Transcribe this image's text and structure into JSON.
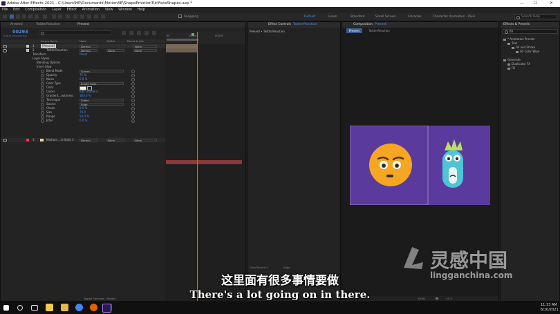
{
  "window": {
    "title": "Adobe After Effects 2021 - C:\\Users\\HP\\Documents\\MotionAE\\ShapeEmotionTut\\FaceShapes.aep *",
    "controls": [
      "—",
      "☐",
      "✕"
    ]
  },
  "menu": [
    "File",
    "Edit",
    "Composition",
    "Layer",
    "Effect",
    "Animation",
    "View",
    "Window",
    "Help"
  ],
  "toolbar": {
    "snapping_label": "Snapping",
    "workspaces": [
      "Default",
      "Learn",
      "Standard",
      "Small Screen",
      "Libraries",
      "Character Animation - Duik"
    ],
    "active_workspace": "Default",
    "search_placeholder": "Search Help"
  },
  "timeline": {
    "tabs": [
      "Armeed",
      "TwitterReaction",
      "Present"
    ],
    "active_tab": "Present",
    "timecode": "00293",
    "timecode_sub": "0:00:11:18 (25.00 fps)",
    "columns": [
      "Source Name",
      "Mode",
      "TrkMat",
      "Parent & Link"
    ],
    "ruler": [
      "0f",
      "0010f",
      "0020f"
    ],
    "layers": [
      {
        "num": "1",
        "name": "[Present]",
        "mode": "Normal",
        "trkmat": "",
        "parent": "None",
        "color": "#c5c5c5"
      },
      {
        "num": "2",
        "name": "TwitterReaction",
        "mode": "Normal",
        "trkmat": "None",
        "parent": "None",
        "color": "#c5c5c5"
      },
      {
        "num": "3",
        "name": "Medium ...le Solid 3",
        "mode": "Normal",
        "trkmat": "None",
        "parent": "None",
        "color": "#e04040"
      }
    ],
    "transform_label": "Transform",
    "reset_label": "Reset",
    "layer_styles_label": "Layer Styles",
    "blending_options_label": "Blending Options",
    "inner_glow_label": "Inner Glow",
    "properties": [
      {
        "name": "Blend Mode",
        "value": "Screen",
        "type": "dropdown"
      },
      {
        "name": "Opacity",
        "value": "75 %",
        "type": "value"
      },
      {
        "name": "Noise",
        "value": "0.0 %",
        "type": "value"
      },
      {
        "name": "Color Type",
        "value": "Single Color",
        "type": "dropdown"
      },
      {
        "name": "Color",
        "value": "",
        "type": "swatch"
      },
      {
        "name": "Colors",
        "value": "Edit Gradient...",
        "type": "value"
      },
      {
        "name": "Gradient...oothness",
        "value": "100.0 %",
        "type": "value"
      },
      {
        "name": "Technique",
        "value": "Softer",
        "type": "dropdown"
      },
      {
        "name": "Source",
        "value": "Edge",
        "type": "dropdown"
      },
      {
        "name": "Choke",
        "value": "0.0 %",
        "type": "value"
      },
      {
        "name": "Size",
        "value": "79.0",
        "type": "value"
      },
      {
        "name": "Range",
        "value": "50.0 %",
        "type": "value"
      },
      {
        "name": "Jitter",
        "value": "0.0 %",
        "type": "value"
      }
    ],
    "toggle_label": "Toggle Switches / Modes"
  },
  "effect_controls": {
    "tab_label": "Effect Controls",
    "tab_target": "TwitterReaction",
    "subheader": "Present • TwitterReaction",
    "footer_labels": [
      "Dub Record 2",
      "Align"
    ]
  },
  "composition": {
    "tab_label": "Composition",
    "tab_target": "Present",
    "view_tabs": [
      "Present",
      "TwitterReaction"
    ],
    "bg_color": "#5b3a9e",
    "emoji_color": "#f5a623",
    "character_color": "#4ec5d6",
    "footer_zoom": "(Full)",
    "footer_exposure": "+0.0"
  },
  "effects_presets": {
    "title": "Effects & Presets",
    "search_value": "fill",
    "tree": [
      {
        "label": "* Animation Presets",
        "indent": 0
      },
      {
        "label": "Text",
        "indent": 1
      },
      {
        "label": "Fill and Stroke",
        "indent": 2
      },
      {
        "label": "Fill Color Wipe",
        "indent": 3
      },
      {
        "label": "Generate",
        "indent": 0
      },
      {
        "label": "Duplicator FX",
        "indent": 1
      },
      {
        "label": "Fill",
        "indent": 1
      }
    ]
  },
  "subtitle": {
    "zh": "这里面有很多事情要做",
    "en": "There's a lot going on in there."
  },
  "watermark": {
    "brand_cn": "灵感中国",
    "brand_url": "lingganchina.com"
  },
  "taskbar": {
    "time": "11:33 AM",
    "date": "6/10/2021"
  }
}
